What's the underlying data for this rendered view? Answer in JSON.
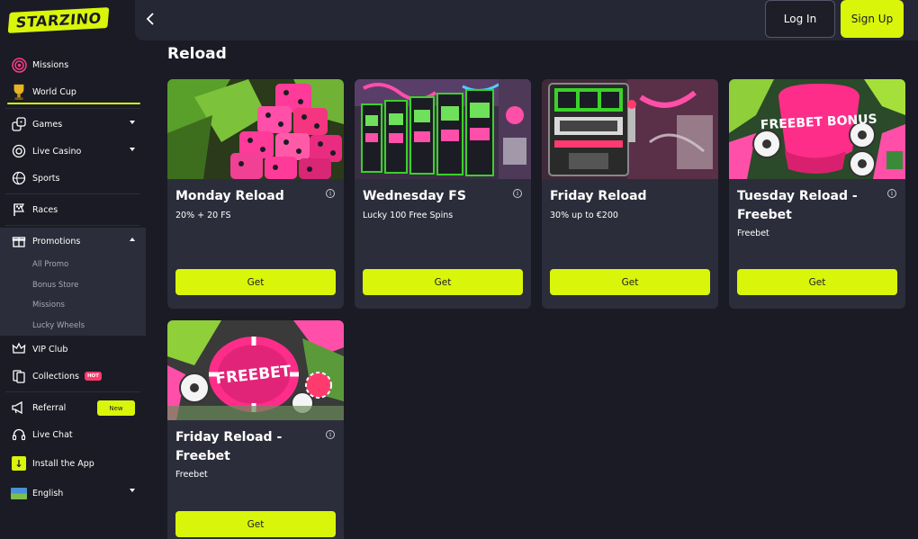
{
  "brand": {
    "logo_text": "STARZINO"
  },
  "sidebar": {
    "items": [
      {
        "label": "Missions",
        "icon": "target-icon"
      },
      {
        "label": "World Cup",
        "icon": "trophy-icon"
      },
      {
        "label": "Games",
        "icon": "dice-icon"
      },
      {
        "label": "Live Casino",
        "icon": "chip-icon"
      },
      {
        "label": "Sports",
        "icon": "ball-icon"
      },
      {
        "label": "Races",
        "icon": "flag-icon"
      },
      {
        "label": "Promotions",
        "icon": "gift-icon"
      },
      {
        "label": "VIP Club",
        "icon": "crown-icon"
      },
      {
        "label": "Collections",
        "icon": "cards-icon",
        "badge": "HOT"
      },
      {
        "label": "Referral",
        "icon": "megaphone-icon",
        "badge": "New"
      },
      {
        "label": "Live Chat",
        "icon": "headset-icon"
      },
      {
        "label": "Install the App",
        "icon": "download-icon"
      },
      {
        "label": "English",
        "icon": "language-flag-icon"
      }
    ],
    "promotions_sub": [
      "All Promo",
      "Bonus Store",
      "Missions",
      "Lucky Wheels"
    ]
  },
  "header": {
    "login_label": "Log In",
    "signup_label": "Sign Up"
  },
  "main": {
    "section_title": "Reload",
    "cards": [
      {
        "title": "Monday Reload",
        "subtitle": "20% + 20 FS",
        "button": "Get"
      },
      {
        "title": "Wednesday FS",
        "subtitle": "Lucky 100 Free Spins",
        "button": "Get"
      },
      {
        "title": "Friday Reload",
        "subtitle": "30% up to €200",
        "button": "Get"
      },
      {
        "title": "Tuesday Reload - Freebet",
        "subtitle": "Freebet",
        "button": "Get",
        "image_text": "FREEBET BONUS"
      },
      {
        "title": "Friday Reload - Freebet",
        "subtitle": "Freebet",
        "button": "Get",
        "image_text": "FREEBET"
      }
    ]
  },
  "colors": {
    "accent": "#d9f50a",
    "background": "#1a1b24",
    "card": "#2c2d3a",
    "hot": "#ff3b6e",
    "pink": "#ff2d8a"
  }
}
